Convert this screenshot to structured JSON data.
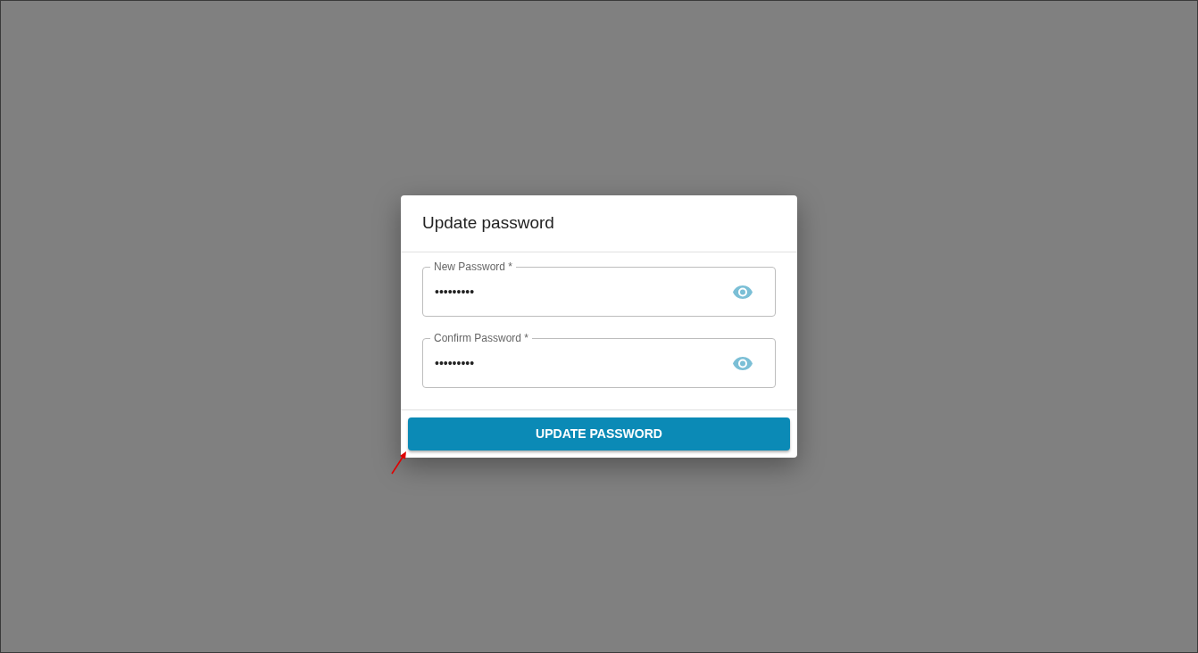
{
  "dialog": {
    "title": "Update password",
    "fields": [
      {
        "label": "New Password *",
        "value": "•••••••••"
      },
      {
        "label": "Confirm Password *",
        "value": "•••••••••"
      }
    ],
    "button": "UPDATE PASSWORD"
  }
}
